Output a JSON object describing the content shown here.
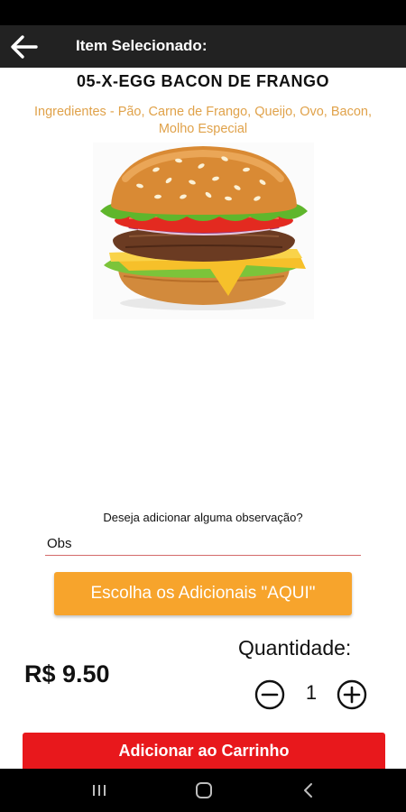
{
  "header": {
    "title": "Item Selecionado:"
  },
  "product": {
    "name": "05-X-EGG BACON DE FRANGO",
    "ingredients": "Ingredientes - Pão, Carne de Frango, Queijo, Ovo, Bacon, Molho Especial",
    "image_icon": "hamburger-image"
  },
  "observation": {
    "question": "Deseja adicionar alguma observação?",
    "placeholder": "Obs",
    "value": ""
  },
  "addons_button": {
    "label": "Escolha os Adicionais \"AQUI\""
  },
  "price": {
    "label": "R$ 9.50"
  },
  "quantity": {
    "label": "Quantidade:",
    "value": "1"
  },
  "cart_button": {
    "label": "Adicionar ao Carrinho"
  },
  "colors": {
    "app_bar": "#222222",
    "ingredients_text": "#e0a24a",
    "addons_button": "#f7a42c",
    "cart_button": "#e8181c"
  },
  "nav": {
    "icons": [
      "recent-apps-icon",
      "home-icon",
      "back-nav-icon"
    ]
  }
}
